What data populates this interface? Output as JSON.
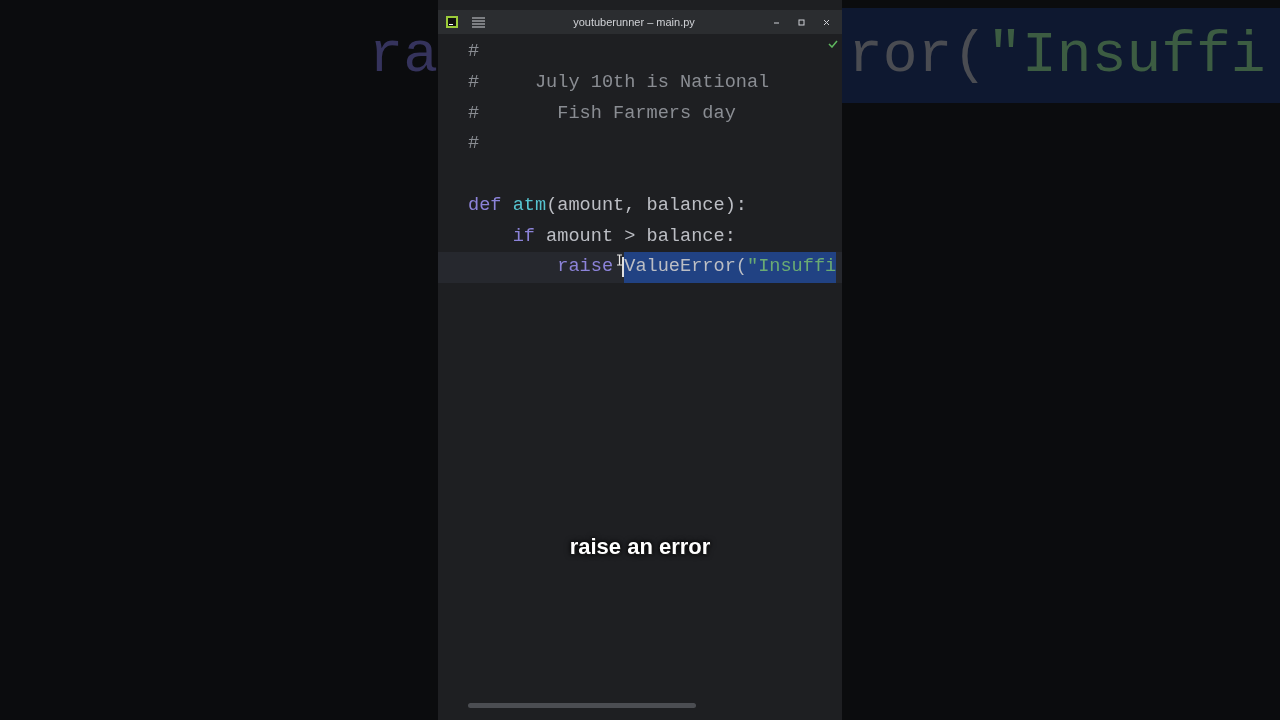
{
  "backdrop": {
    "left": [
      {
        "text": "ra",
        "kind": "keyword"
      }
    ],
    "right": [
      {
        "text": "ror(",
        "kind": "plain"
      },
      {
        "text": "\"Insuffi",
        "kind": "string"
      }
    ]
  },
  "window": {
    "title": "youtuberunner – main.py"
  },
  "editor": {
    "lines": [
      {
        "current": false,
        "tokens": [
          {
            "text": "#",
            "kind": "comment",
            "selected": false
          }
        ]
      },
      {
        "current": false,
        "tokens": [
          {
            "text": "#     July 10th is National",
            "kind": "comment",
            "selected": false
          }
        ]
      },
      {
        "current": false,
        "tokens": [
          {
            "text": "#       Fish Farmers day",
            "kind": "comment",
            "selected": false
          }
        ]
      },
      {
        "current": false,
        "tokens": [
          {
            "text": "#",
            "kind": "comment",
            "selected": false
          }
        ]
      },
      {
        "current": false
      },
      {
        "current": false,
        "tokens": [
          {
            "text": "def ",
            "kind": "keyword",
            "selected": false
          },
          {
            "text": "atm",
            "kind": "function",
            "selected": false
          },
          {
            "text": "(amount, balance):",
            "kind": "plain",
            "selected": false
          }
        ]
      },
      {
        "current": false,
        "tokens": [
          {
            "text": "    if",
            "kind": "keyword",
            "selected": false
          },
          {
            "text": " amount > balance:",
            "kind": "plain",
            "selected": false
          }
        ]
      },
      {
        "current": true,
        "tokens": [
          {
            "text": "        raise",
            "kind": "keyword",
            "selected": false
          },
          {
            "text": "ValueError(",
            "kind": "plain",
            "selected": true
          },
          {
            "text": "\"Insuffi",
            "kind": "string",
            "selected": true
          }
        ]
      }
    ]
  },
  "caption": "raise an error"
}
